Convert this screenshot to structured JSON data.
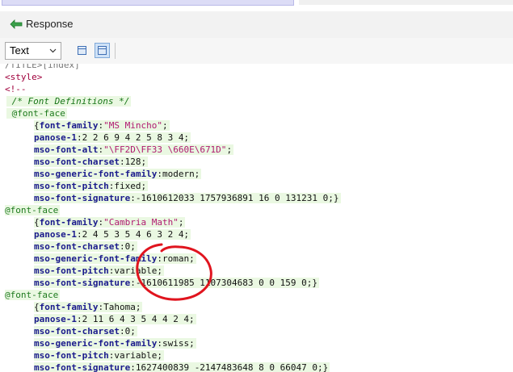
{
  "response_tab": {
    "label": "Response",
    "icon": "back-arrow-icon"
  },
  "toolbar": {
    "view_mode": "Text"
  },
  "code_lines": [
    {
      "indent": 0,
      "hl": false,
      "parts": [
        {
          "c": "cut",
          "t": "/TITLE>[index]"
        }
      ]
    },
    {
      "indent": 0,
      "hl": false,
      "parts": [
        {
          "c": "tag",
          "t": "<style>"
        }
      ]
    },
    {
      "indent": 0,
      "hl": false,
      "parts": [
        {
          "c": "tag",
          "t": "<!--"
        }
      ]
    },
    {
      "indent": 1,
      "hl": true,
      "parts": [
        {
          "c": "cm",
          "t": " /* Font Definitions */"
        }
      ]
    },
    {
      "indent": 1,
      "hl": true,
      "parts": [
        {
          "c": "at",
          "t": " @font-face"
        }
      ]
    },
    {
      "indent": 2,
      "hl": true,
      "parts": [
        {
          "c": "v",
          "t": "{"
        },
        {
          "c": "k",
          "t": "font-family"
        },
        {
          "c": "v",
          "t": ":"
        },
        {
          "c": "s",
          "t": "\"MS Mincho\""
        },
        {
          "c": "v",
          "t": ";"
        }
      ]
    },
    {
      "indent": 2,
      "hl": true,
      "parts": [
        {
          "c": "k",
          "t": "panose-1"
        },
        {
          "c": "v",
          "t": ":2 2 6 9 4 2 5 8 3 4;"
        }
      ]
    },
    {
      "indent": 2,
      "hl": true,
      "parts": [
        {
          "c": "k",
          "t": "mso-font-alt"
        },
        {
          "c": "v",
          "t": ":"
        },
        {
          "c": "s",
          "t": "\"\\FF2D\\FF33 \\660E\\671D\""
        },
        {
          "c": "v",
          "t": ";"
        }
      ]
    },
    {
      "indent": 2,
      "hl": true,
      "parts": [
        {
          "c": "k",
          "t": "mso-font-charset"
        },
        {
          "c": "v",
          "t": ":128;"
        }
      ]
    },
    {
      "indent": 2,
      "hl": true,
      "parts": [
        {
          "c": "k",
          "t": "mso-generic-font-family"
        },
        {
          "c": "v",
          "t": ":modern;"
        }
      ]
    },
    {
      "indent": 2,
      "hl": true,
      "parts": [
        {
          "c": "k",
          "t": "mso-font-pitch"
        },
        {
          "c": "v",
          "t": ":fixed;"
        }
      ]
    },
    {
      "indent": 2,
      "hl": true,
      "parts": [
        {
          "c": "k",
          "t": "mso-font-signature"
        },
        {
          "c": "v",
          "t": ":-1610612033 1757936891 16 0 131231 0;}"
        }
      ]
    },
    {
      "indent": 0,
      "hl": true,
      "parts": [
        {
          "c": "at",
          "t": "@font-face"
        }
      ]
    },
    {
      "indent": 2,
      "hl": true,
      "parts": [
        {
          "c": "v",
          "t": "{"
        },
        {
          "c": "k",
          "t": "font-family"
        },
        {
          "c": "v",
          "t": ":"
        },
        {
          "c": "s",
          "t": "\"Cambria Math\""
        },
        {
          "c": "v",
          "t": ";"
        }
      ]
    },
    {
      "indent": 2,
      "hl": true,
      "parts": [
        {
          "c": "k",
          "t": "panose-1"
        },
        {
          "c": "v",
          "t": ":2 4 5 3 5 4 6 3 2 4;"
        }
      ]
    },
    {
      "indent": 2,
      "hl": true,
      "parts": [
        {
          "c": "k",
          "t": "mso-font-charset"
        },
        {
          "c": "v",
          "t": ":0;"
        }
      ]
    },
    {
      "indent": 2,
      "hl": true,
      "parts": [
        {
          "c": "k",
          "t": "mso-generic-font-family"
        },
        {
          "c": "v",
          "t": ":roman;"
        }
      ]
    },
    {
      "indent": 2,
      "hl": true,
      "parts": [
        {
          "c": "k",
          "t": "mso-font-pitch"
        },
        {
          "c": "v",
          "t": ":variable;"
        }
      ]
    },
    {
      "indent": 2,
      "hl": true,
      "parts": [
        {
          "c": "k",
          "t": "mso-font-signature"
        },
        {
          "c": "v",
          "t": ":-1610611985 1107304683 0 0 159 0;}"
        }
      ]
    },
    {
      "indent": 0,
      "hl": true,
      "parts": [
        {
          "c": "at",
          "t": "@font-face"
        }
      ]
    },
    {
      "indent": 2,
      "hl": true,
      "parts": [
        {
          "c": "v",
          "t": "{"
        },
        {
          "c": "k",
          "t": "font-family"
        },
        {
          "c": "v",
          "t": ":Tahoma;"
        }
      ]
    },
    {
      "indent": 2,
      "hl": true,
      "parts": [
        {
          "c": "k",
          "t": "panose-1"
        },
        {
          "c": "v",
          "t": ":2 11 6 4 3 5 4 4 2 4;"
        }
      ]
    },
    {
      "indent": 2,
      "hl": true,
      "parts": [
        {
          "c": "k",
          "t": "mso-font-charset"
        },
        {
          "c": "v",
          "t": ":0;"
        }
      ]
    },
    {
      "indent": 2,
      "hl": true,
      "parts": [
        {
          "c": "k",
          "t": "mso-generic-font-family"
        },
        {
          "c": "v",
          "t": ":swiss;"
        }
      ]
    },
    {
      "indent": 2,
      "hl": true,
      "parts": [
        {
          "c": "k",
          "t": "mso-font-pitch"
        },
        {
          "c": "v",
          "t": ":variable;"
        }
      ]
    },
    {
      "indent": 2,
      "hl": true,
      "parts": [
        {
          "c": "k",
          "t": "mso-font-signature"
        },
        {
          "c": "v",
          "t": ":1627400839 -2147483648 8 0 66047 0;}"
        }
      ]
    }
  ],
  "annotation": {
    "shape": "hand-drawn ellipse",
    "color": "#e0141e"
  },
  "colors": {
    "keyword": "#1a1a8c",
    "string": "#b01a70",
    "tag": "#a0003c",
    "comment": "#177517",
    "highlight": "#eaf8e2"
  }
}
